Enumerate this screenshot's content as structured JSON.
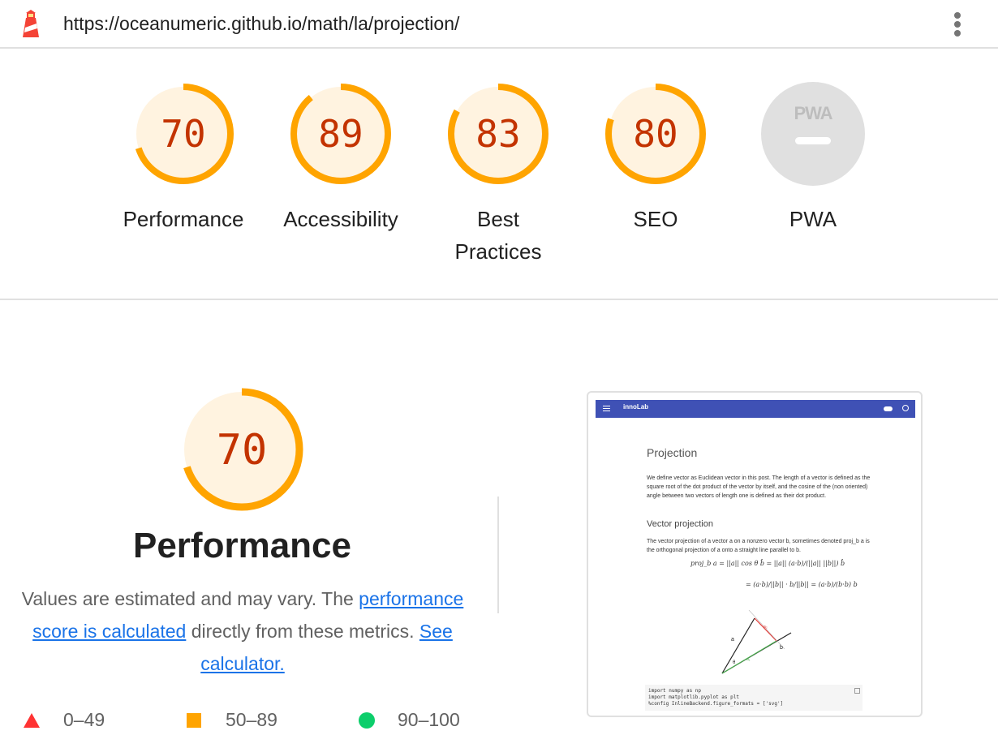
{
  "header": {
    "url": "https://oceanumeric.github.io/math/la/projection/",
    "logo_icon": "lighthouse-icon",
    "menu_icon": "kebab-menu-icon"
  },
  "colors": {
    "average_stroke": "#ffa400",
    "average_fill": "#fff3e0",
    "average_text": "#c33300",
    "na_fill": "#e0e0e0",
    "na_text": "#bdbdbd",
    "link": "#1a73e8",
    "fail": "#ff3333",
    "pass": "#0cce6b"
  },
  "scores": [
    {
      "id": "performance",
      "label": "Performance",
      "score": 70
    },
    {
      "id": "accessibility",
      "label": "Accessibility",
      "score": 89
    },
    {
      "id": "best-practices",
      "label": "Best Practices",
      "score": 83
    },
    {
      "id": "seo",
      "label": "SEO",
      "score": 80
    },
    {
      "id": "pwa",
      "label": "PWA",
      "badge": "PWA",
      "score": null
    }
  ],
  "performance": {
    "score": 70,
    "title": "Performance",
    "desc_before": "Values are estimated and may vary. The ",
    "desc_link1": "performance score is calculated",
    "desc_middle": " directly from these metrics. ",
    "desc_link2": "See calculator."
  },
  "legend": [
    {
      "shape": "triangle",
      "range": "0–49"
    },
    {
      "shape": "square",
      "range": "50–89"
    },
    {
      "shape": "circle",
      "range": "90–100"
    }
  ],
  "screenshot": {
    "app_name": "innoLab",
    "title": "Projection",
    "para1": "We define vector as Euclidean vector in this post. The length of a vector is defined as the square root of the dot product of the vector by itself, and the cosine of the (non oriented) angle between two vectors of length one is defined as their dot product.",
    "heading2": "Vector projection",
    "para2": "The vector projection of a vector a on a nonzero vector b, sometimes denoted proj_b a is the orthogonal projection of a onto a straight line parallel to b.",
    "eq1": "proj_b a = ||a|| cos θ b̂ = ||a|| (a·b)/(||a|| ||b||) b̂",
    "eq2": "= (a·b)/||b|| · b/||b|| = (a·b)/(b·b) b",
    "fig_a": "a",
    "fig_b": "b",
    "fig_a1": "a₁",
    "fig_a2": "a₂",
    "fig_theta": "θ",
    "code1": "import numpy as np",
    "code2": "import matplotlib.pyplot as plt",
    "code3": "%config InlineBackend.figure_formats = ['svg']"
  }
}
